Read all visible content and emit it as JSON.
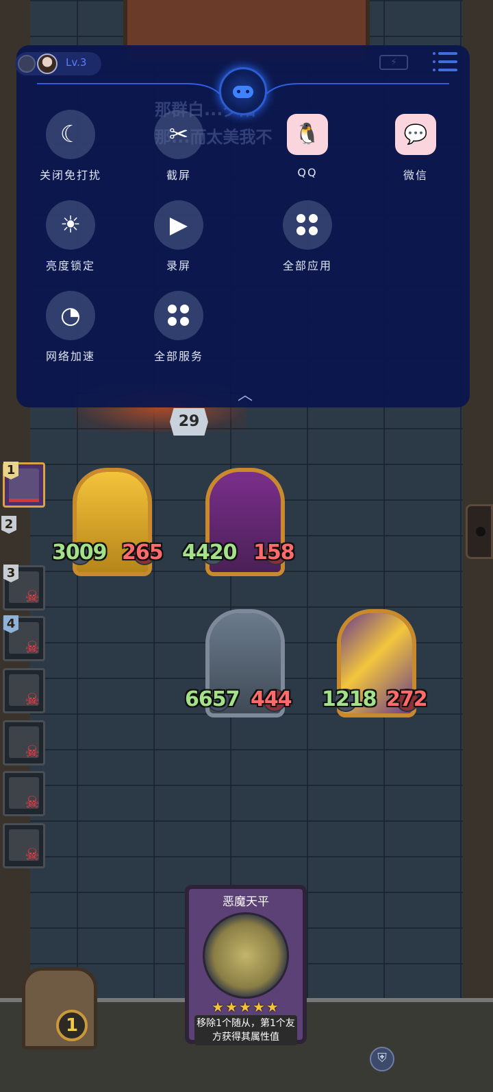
{
  "overlay": {
    "level": "Lv.3",
    "tiles": [
      {
        "id": "dnd",
        "label": "关闭免打扰",
        "icon": "moon-icon"
      },
      {
        "id": "screenshot",
        "label": "截屏",
        "icon": "scissors-icon"
      },
      {
        "id": "qq",
        "label": "QQ",
        "icon": "qq-icon"
      },
      {
        "id": "wechat",
        "label": "微信",
        "icon": "wechat-icon"
      },
      {
        "id": "brightness",
        "label": "亮度锁定",
        "icon": "brightness-lock-icon"
      },
      {
        "id": "record",
        "label": "录屏",
        "icon": "video-camera-icon"
      },
      {
        "id": "all_apps",
        "label": "全部应用",
        "icon": "grid-icon"
      },
      {
        "id": "accelerate",
        "label": "网络加速",
        "icon": "speed-icon"
      },
      {
        "id": "all_services",
        "label": "全部服务",
        "icon": "grid-icon"
      }
    ]
  },
  "game": {
    "enemy_hero_hp": "29",
    "queue": [
      "1",
      "2",
      "3",
      "4"
    ],
    "minions": [
      {
        "attack": "3009",
        "health": "265",
        "style": "gold"
      },
      {
        "attack": "4420",
        "health": "158",
        "style": "purple"
      },
      {
        "attack": "6657",
        "health": "444",
        "style": "silver"
      },
      {
        "attack": "1218",
        "health": "272",
        "style": "yellowpurple"
      }
    ],
    "spell": {
      "title": "恶魔天平",
      "stars": "★★★★★",
      "desc": "移除1个随从，第1个友方获得其属性值"
    },
    "gold": "1"
  },
  "colors": {
    "panel": "#0a164e",
    "accent": "#3f82ff",
    "attack": "#a4e28a",
    "health": "#ff6b6b"
  }
}
